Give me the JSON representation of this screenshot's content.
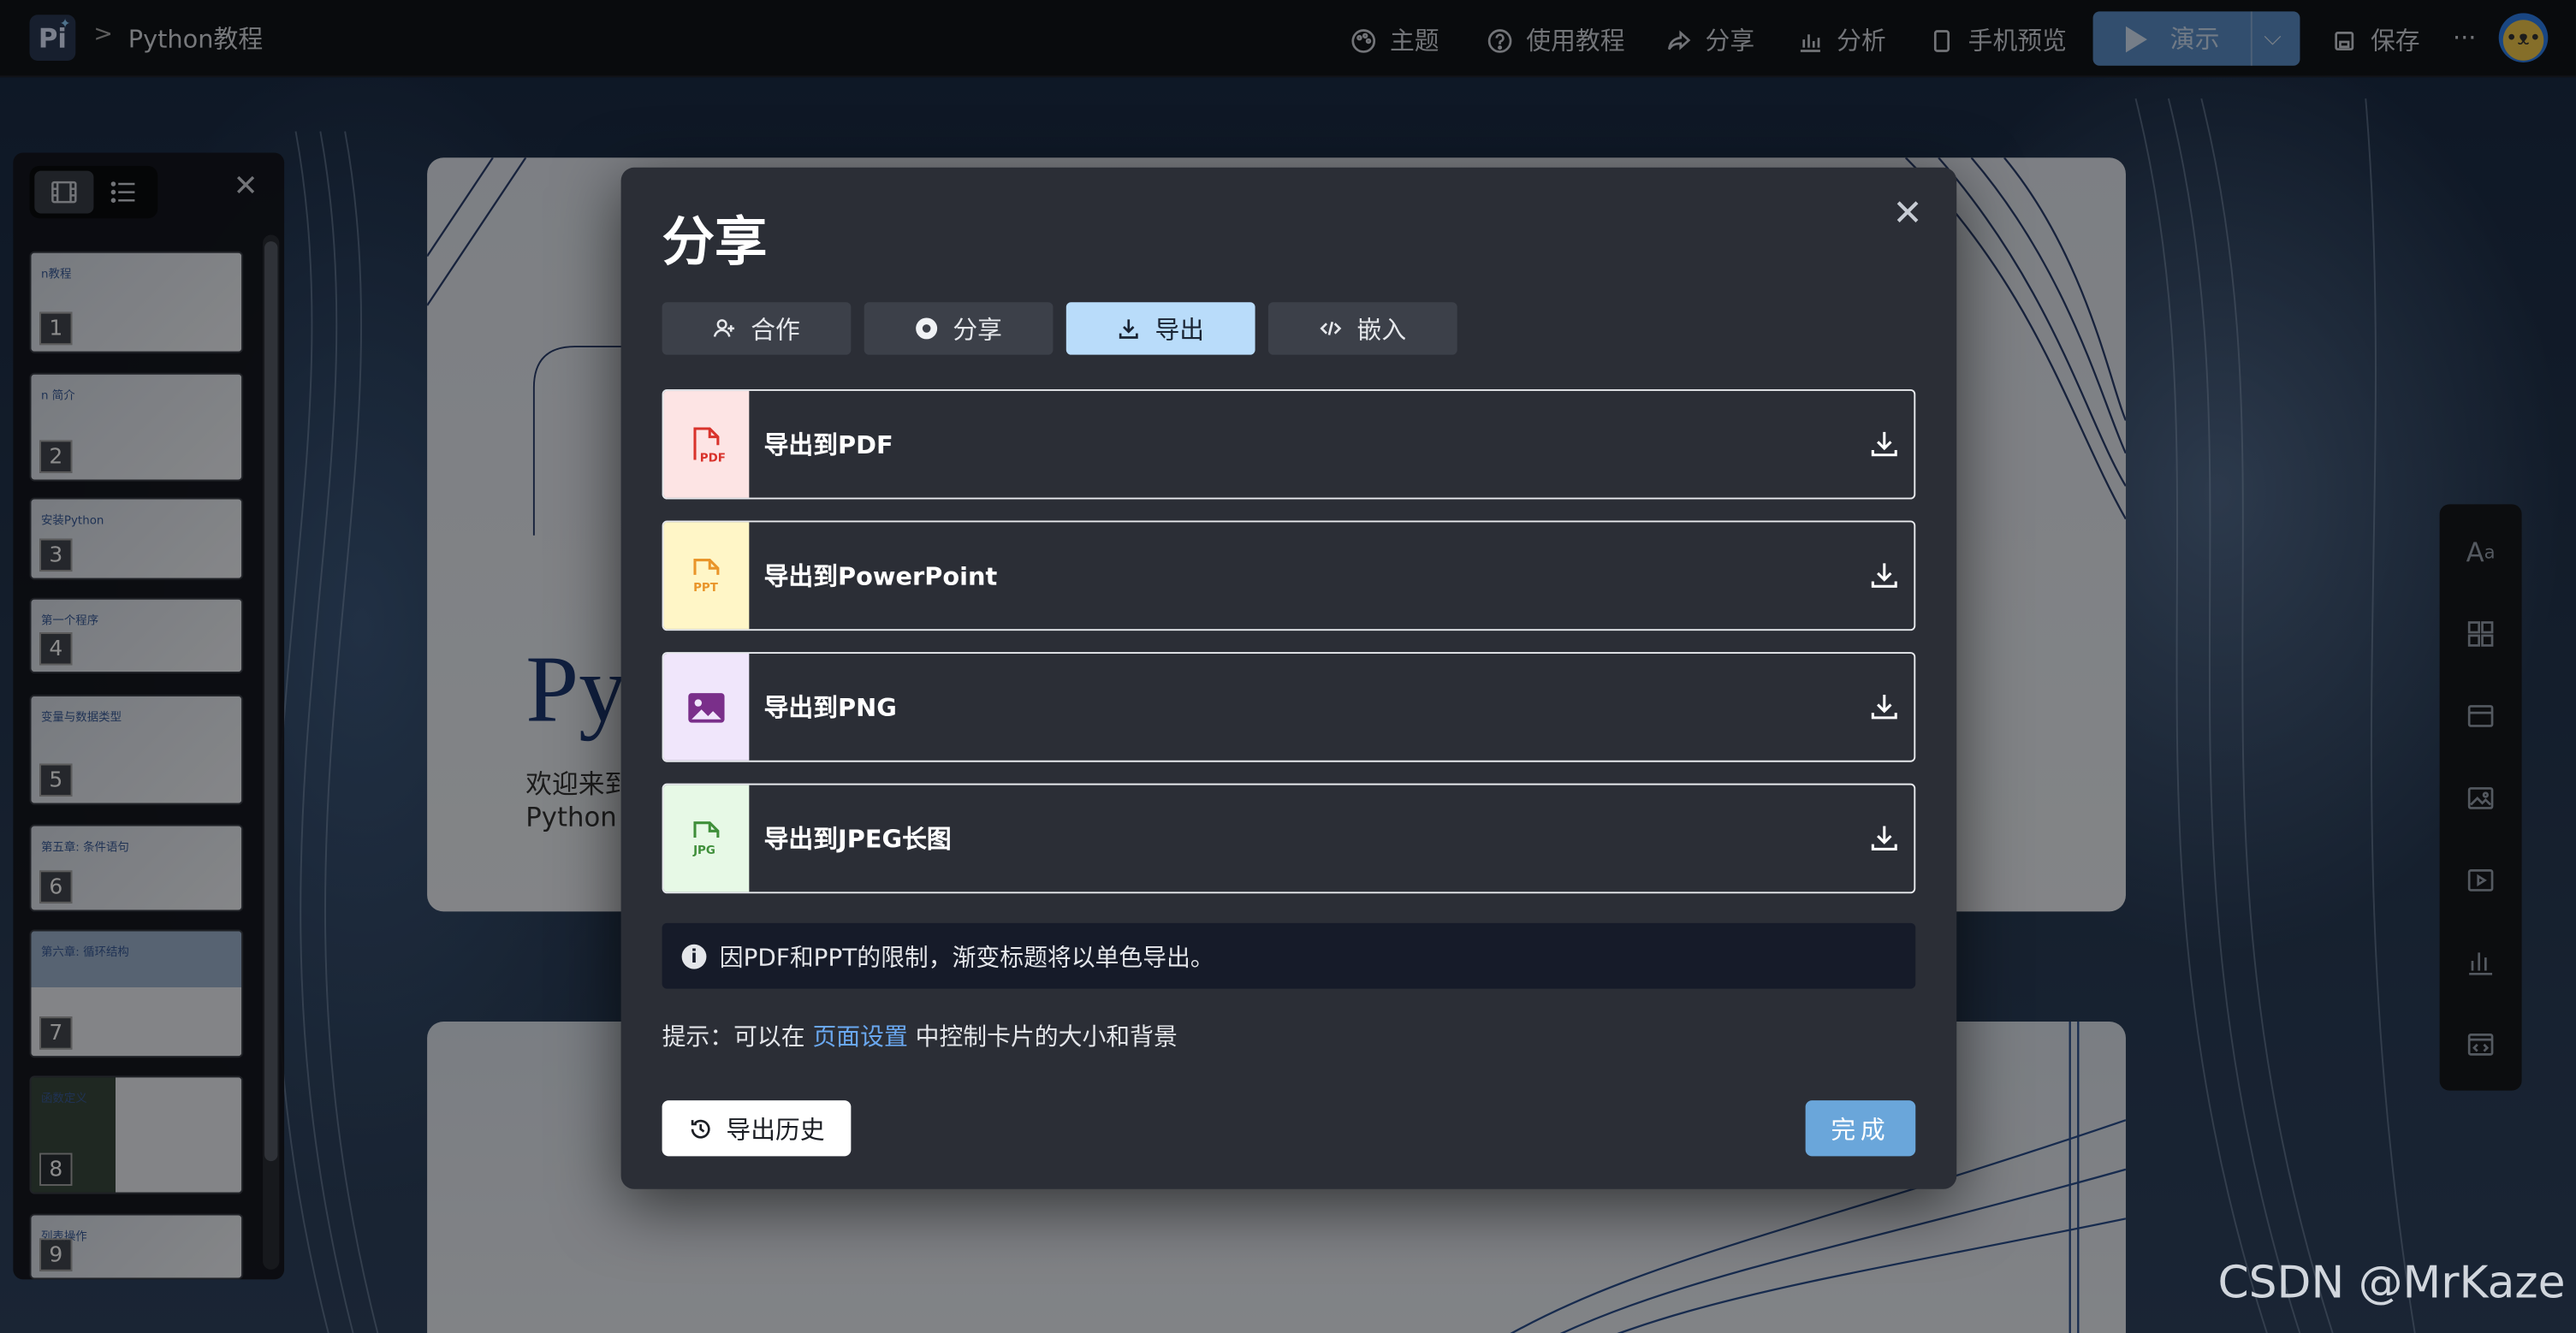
{
  "app": {
    "breadcrumb_sep": ">",
    "doc_title": "Python教程",
    "logo_text": "Pi"
  },
  "toolbar": {
    "theme": "主题",
    "tutorial": "使用教程",
    "share": "分享",
    "analytics": "分析",
    "mobile_preview": "手机预览",
    "present": "演示",
    "save": "保存",
    "more": "···"
  },
  "sidebar": {
    "slides": [
      {
        "num": "1",
        "title": "n教程"
      },
      {
        "num": "2",
        "title": "n 简介"
      },
      {
        "num": "3",
        "title": "安装Python"
      },
      {
        "num": "4",
        "title": "第一个程序"
      },
      {
        "num": "5",
        "title": "变量与数据类型"
      },
      {
        "num": "6",
        "title": "第五章: 条件语句"
      },
      {
        "num": "7",
        "title": "第六章: 循环结构"
      },
      {
        "num": "8",
        "title": "函数定义"
      },
      {
        "num": "9",
        "title": "列表操作"
      }
    ]
  },
  "slide_bg": {
    "title": "Py",
    "line1": "欢迎来到",
    "line2": "Python"
  },
  "modal": {
    "title": "分享",
    "tabs": [
      {
        "label": "合作",
        "icon": "user-add-icon"
      },
      {
        "label": "分享",
        "icon": "share-circle-icon"
      },
      {
        "label": "导出",
        "icon": "download-icon",
        "active": true
      },
      {
        "label": "嵌入",
        "icon": "code-icon"
      }
    ],
    "exports": [
      {
        "label": "导出到PDF",
        "badge": "PDF",
        "icon_bg": "#fde4e4",
        "icon_color": "#d9332c"
      },
      {
        "label": "导出到PowerPoint",
        "badge": "PPT",
        "icon_bg": "#fff6c7",
        "icon_color": "#e9952a"
      },
      {
        "label": "导出到PNG",
        "badge": "",
        "icon_bg": "#f0e6fb",
        "icon_color": "#7a2f8a"
      },
      {
        "label": "导出到JPEG长图",
        "badge": "JPG",
        "icon_bg": "#e7f9e6",
        "icon_color": "#3f8f3a"
      }
    ],
    "notice": "因PDF和PPT的限制，渐变标题将以单色导出。",
    "hint_prefix": "提示：可以在 ",
    "hint_link": "页面设置",
    "hint_suffix": " 中控制卡片的大小和背景",
    "history_button": "导出历史",
    "done_button": "完成"
  },
  "watermark": "CSDN @MrKaze",
  "colors": {
    "accent": "#b9dcfa",
    "present": "#5b8fc9",
    "done": "#6aa6da",
    "link": "#6aa8f0"
  }
}
